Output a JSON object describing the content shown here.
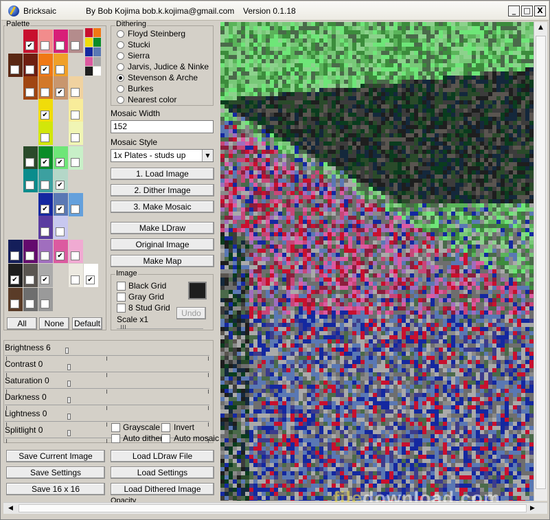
{
  "window": {
    "app_name": "Bricksaic",
    "author": "By Bob Kojima bob.k.kojima@gmail.com",
    "version": "Version 0.1.18",
    "min_glyph": "_",
    "max_glyph": "□",
    "close_glyph": "X"
  },
  "palette": {
    "label": "Palette",
    "buttons": {
      "all": "All",
      "none": "None",
      "default": "Default"
    },
    "check_glyph": "✔"
  },
  "dithering": {
    "label": "Dithering",
    "options": [
      "Floyd Steinberg",
      "Stucki",
      "Sierra",
      "Jarvis, Judice & Ninke",
      "Stevenson & Arche",
      "Burkes",
      "Nearest color"
    ],
    "selected_index": 4
  },
  "mosaic_width": {
    "label": "Mosaic Width",
    "value": "152"
  },
  "mosaic_style": {
    "label": "Mosaic Style",
    "value": "1x Plates - studs up",
    "arrow": "▼"
  },
  "actions": {
    "load_image": "1.    Load Image",
    "dither_image": "2.    Dither Image",
    "make_mosaic": "3.    Make Mosaic",
    "make_ldraw": "Make LDraw",
    "original_image": "Original Image",
    "make_map": "Make Map"
  },
  "image_group": {
    "label": "Image",
    "black_grid": "Black Grid",
    "gray_grid": "Gray Grid",
    "stud_grid": "8 Stud Grid",
    "undo": "Undo",
    "scale": "Scale x1",
    "swatch_color": "#1e1e1e"
  },
  "adjustments": [
    {
      "label": "Brightness 6",
      "level": 0.3
    },
    {
      "label": "Contrast 0",
      "level": 0.31
    },
    {
      "label": "Saturation 0",
      "level": 0.31
    },
    {
      "label": "Darkness 0",
      "level": 0.31
    },
    {
      "label": "Lightness 0",
      "level": 0.31
    },
    {
      "label": "Splitlight 0",
      "level": 0.31
    }
  ],
  "options": {
    "grayscale": "Grayscale",
    "invert": "Invert",
    "auto_dither": "Auto dither",
    "auto_mosaic": "Auto mosaic"
  },
  "file_buttons": {
    "save_current_image": "Save Current Image",
    "save_settings": "Save Settings",
    "save_16": "Save 16 x 16",
    "load_ldraw": "Load LDraw File",
    "load_settings": "Load Settings",
    "load_dithered": "Load Dithered Image",
    "opacity": "Opacity"
  },
  "watermark": {
    "part1": "file",
    "part2": "download.com"
  },
  "scroll_glyphs": {
    "left": "◀",
    "right": "▶",
    "up": "▲",
    "down": "▼"
  }
}
